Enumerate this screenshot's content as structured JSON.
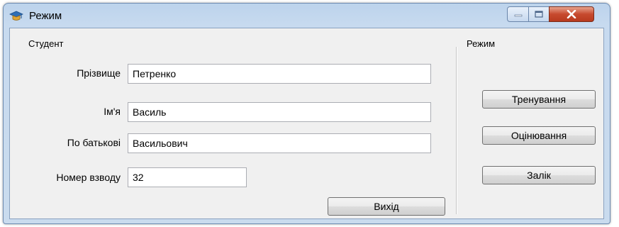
{
  "window": {
    "title": "Режим",
    "icon": "graduation-cap-icon",
    "controls": {
      "minimize": "minimize-icon",
      "maximize": "maximize-icon",
      "close": "close-icon"
    }
  },
  "student": {
    "group_label": "Студент",
    "fields": {
      "surname": {
        "label": "Прізвище",
        "value": "Петренко"
      },
      "name": {
        "label": "Ім'я",
        "value": "Василь"
      },
      "patronymic": {
        "label": "По батькові",
        "value": "Васильович"
      },
      "platoon": {
        "label": "Номер взводу",
        "value": "32"
      }
    },
    "exit_label": "Вихід"
  },
  "mode": {
    "group_label": "Режим",
    "buttons": [
      "Тренування",
      "Оцінювання",
      "Залік"
    ]
  },
  "colors": {
    "frame": "#c7daef",
    "client": "#f0f0f0",
    "close": "#c74a2e"
  }
}
